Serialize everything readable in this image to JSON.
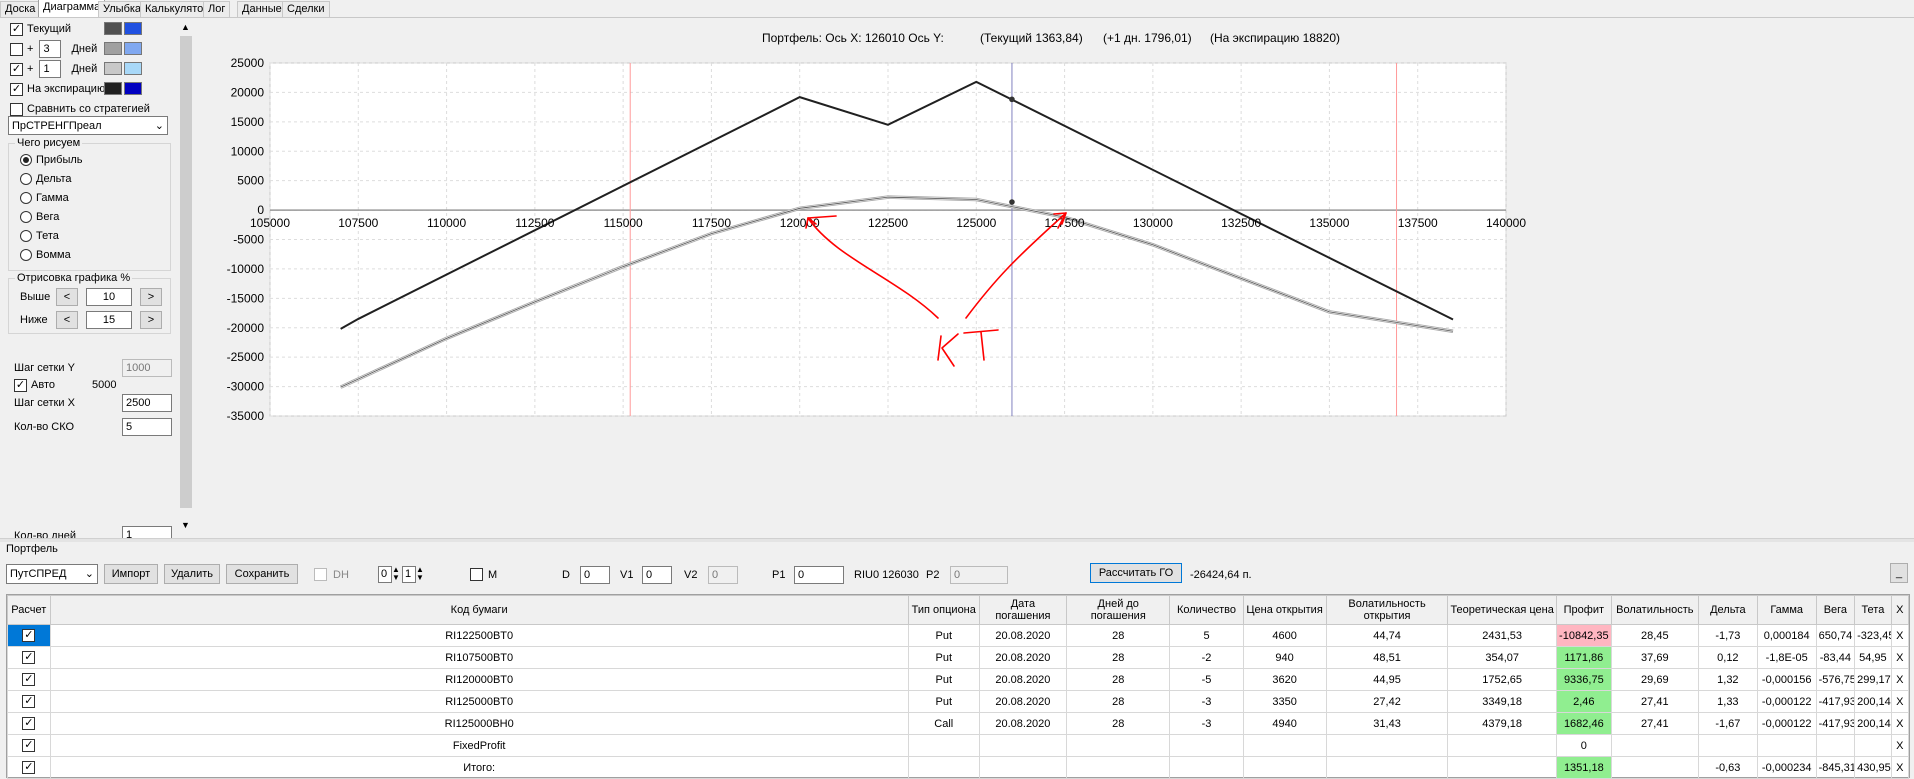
{
  "tabs": [
    "Доска",
    "Диаграмма",
    "Улыбка",
    "Калькулятор",
    "Лог",
    "Данные",
    "Сделки"
  ],
  "left_panel": {
    "current": {
      "label": "Текущий",
      "checked": true,
      "color1": "#505050",
      "color2": "#2050e0"
    },
    "plus_days_1": {
      "plus": "+",
      "value": "3",
      "unit": "Дней",
      "checked": false,
      "color1": "#a0a0a0",
      "color2": "#80a8f0"
    },
    "plus_days_2": {
      "plus": "+",
      "value": "1",
      "unit": "Дней",
      "checked": true,
      "color1": "#c8c8c8",
      "color2": "#a8d8f8"
    },
    "expiry": {
      "label": "На экспирацию",
      "checked": true,
      "color1": "#202020",
      "color2": "#0000c0"
    },
    "compare": {
      "label": "Сравнить со стратегией",
      "checked": false
    },
    "strategy_select": "ПрСТРЕНГПреал",
    "draw_group": {
      "title": "Чего рисуем",
      "options": [
        "Прибыль",
        "Дельта",
        "Гамма",
        "Вега",
        "Тета",
        "Вомма"
      ],
      "selected": 0
    },
    "render_group": {
      "title": "Отрисовка графика %",
      "above_label": "Выше",
      "above_value": "10",
      "below_label": "Ниже",
      "below_value": "15",
      "dec": "<",
      "inc": ">"
    },
    "grid_y_label": "Шаг сетки Y",
    "grid_y_value": "1000",
    "auto_label": "Авто",
    "auto_checked": true,
    "auto_value": "5000",
    "grid_x_label": "Шаг сетки X",
    "grid_x_value": "2500",
    "sko_label": "Кол-во СКО",
    "sko_value": "5",
    "days_label": "Кол-во дней",
    "days_value": "1"
  },
  "chart_header": {
    "portfolio_text": "Портфель: Ось X: 126010 Ось Y:",
    "current_text": "(Текущий 1363,84)",
    "plus_day_text": "(+1 дн. 1796,01)",
    "expiry_text": "(На экспирацию 18820)"
  },
  "chart_data": {
    "type": "line",
    "xlim": [
      105000,
      140000
    ],
    "ylim": [
      -35000,
      25000
    ],
    "x_ticks": [
      "105000",
      "107500",
      "110000",
      "112500",
      "115000",
      "117500",
      "120000",
      "122500",
      "125000",
      "127500",
      "130000",
      "132500",
      "135000",
      "137500",
      "140000"
    ],
    "y_ticks": [
      "25000",
      "20000",
      "15000",
      "10000",
      "5000",
      "0",
      "-5000",
      "-10000",
      "-15000",
      "-20000",
      "-25000",
      "-30000",
      "-35000"
    ],
    "grid": true,
    "series": [
      {
        "name": "На экспирацию",
        "color": "#202020",
        "x": [
          107000,
          107500,
          120000,
          122500,
          125000,
          138500
        ],
        "y": [
          -20200,
          -18500,
          19200,
          14500,
          21800,
          -18600
        ]
      },
      {
        "name": "Текущий",
        "color": "#505050",
        "x": [
          107000,
          110000,
          112500,
          115000,
          117500,
          120000,
          122500,
          125000,
          127500,
          130000,
          132500,
          135000,
          138500
        ],
        "y": [
          -30100,
          -21800,
          -15600,
          -9600,
          -4000,
          300,
          2200,
          1800,
          -1200,
          -5900,
          -11600,
          -17300,
          -20600
        ]
      }
    ],
    "markers": [
      {
        "x": 126010,
        "y": 18820
      },
      {
        "x": 126010,
        "y": 1363.84
      }
    ],
    "vertical_lines": [
      {
        "x": 115200,
        "color": "#ff9999"
      },
      {
        "x": 126010,
        "color": "#8080c0"
      },
      {
        "x": 136900,
        "color": "#ff9999"
      }
    ]
  },
  "annotation": {
    "label": "КТ",
    "color": "#ff0000"
  },
  "portfolio": {
    "label": "Портфель",
    "select": "ПутСПРЕД",
    "import": "Импорт",
    "delete": "Удалить",
    "save": "Сохранить",
    "dh_label": "DH",
    "dh_value1": "0",
    "dh_value2": "1",
    "m_label": "M",
    "d_label": "D",
    "d_value": "0",
    "v1_label": "V1",
    "v1_value": "0",
    "v2_label": "V2",
    "v2_value": "0",
    "p1_label": "P1",
    "p1_value": "0",
    "riu_text": "RIU0 126030",
    "p2_label": "P2",
    "p2_value": "0",
    "calc_button": "Рассчитать ГО",
    "go_value": "-26424,64 п.",
    "minimize": "_"
  },
  "table": {
    "headers": [
      "Расчет",
      "Код бумаги",
      "Тип опциона",
      "Дата погашения",
      "Дней до погашения",
      "Количество",
      "Цена открытия",
      "Волатильность открытия",
      "Теоретическая цена",
      "Профит",
      "Волатильность",
      "Дельта",
      "Гамма",
      "Вега",
      "Тета",
      "X"
    ],
    "rows": [
      {
        "check": "✓",
        "code": "RI122500BT0",
        "type": "Put",
        "date": "20.08.2020",
        "days": "28",
        "qty": "5",
        "price": "4600",
        "vol_open": "44,74",
        "theor": "2431,53",
        "profit": "-10842,35",
        "profit_class": "neg",
        "vol": "28,45",
        "delta": "-1,73",
        "gamma": "0,000184",
        "vega": "650,74",
        "theta": "-323,45",
        "x": "X"
      },
      {
        "check": "✓",
        "code": "RI107500BT0",
        "type": "Put",
        "date": "20.08.2020",
        "days": "28",
        "qty": "-2",
        "price": "940",
        "vol_open": "48,51",
        "theor": "354,07",
        "profit": "1171,86",
        "profit_class": "pos",
        "vol": "37,69",
        "delta": "0,12",
        "gamma": "-1,8E-05",
        "vega": "-83,44",
        "theta": "54,95",
        "x": "X"
      },
      {
        "check": "✓",
        "code": "RI120000BT0",
        "type": "Put",
        "date": "20.08.2020",
        "days": "28",
        "qty": "-5",
        "price": "3620",
        "vol_open": "44,95",
        "theor": "1752,65",
        "profit": "9336,75",
        "profit_class": "pos",
        "vol": "29,69",
        "delta": "1,32",
        "gamma": "-0,000156",
        "vega": "-576,75",
        "theta": "299,17",
        "x": "X"
      },
      {
        "check": "✓",
        "code": "RI125000BT0",
        "type": "Put",
        "date": "20.08.2020",
        "days": "28",
        "qty": "-3",
        "price": "3350",
        "vol_open": "27,42",
        "theor": "3349,18",
        "profit": "2,46",
        "profit_class": "pos",
        "vol": "27,41",
        "delta": "1,33",
        "gamma": "-0,000122",
        "vega": "-417,93",
        "theta": "200,14",
        "x": "X"
      },
      {
        "check": "✓",
        "code": "RI125000BH0",
        "type": "Call",
        "date": "20.08.2020",
        "days": "28",
        "qty": "-3",
        "price": "4940",
        "vol_open": "31,43",
        "theor": "4379,18",
        "profit": "1682,46",
        "profit_class": "pos",
        "vol": "27,41",
        "delta": "-1,67",
        "gamma": "-0,000122",
        "vega": "-417,93",
        "theta": "200,14",
        "x": "X"
      },
      {
        "check": "✓",
        "code": "FixedProfit",
        "type": "",
        "date": "",
        "days": "",
        "qty": "",
        "price": "",
        "vol_open": "",
        "theor": "",
        "profit": "0",
        "profit_class": "",
        "vol": "",
        "delta": "",
        "gamma": "",
        "vega": "",
        "theta": "",
        "x": "X"
      },
      {
        "check": "✓",
        "code": "Итого:",
        "type": "",
        "date": "",
        "days": "",
        "qty": "",
        "price": "",
        "vol_open": "",
        "theor": "",
        "profit": "1351,18",
        "profit_class": "pos",
        "vol": "",
        "delta": "-0,63",
        "gamma": "-0,000234",
        "vega": "-845,31",
        "theta": "430,95",
        "x": "X"
      }
    ]
  }
}
